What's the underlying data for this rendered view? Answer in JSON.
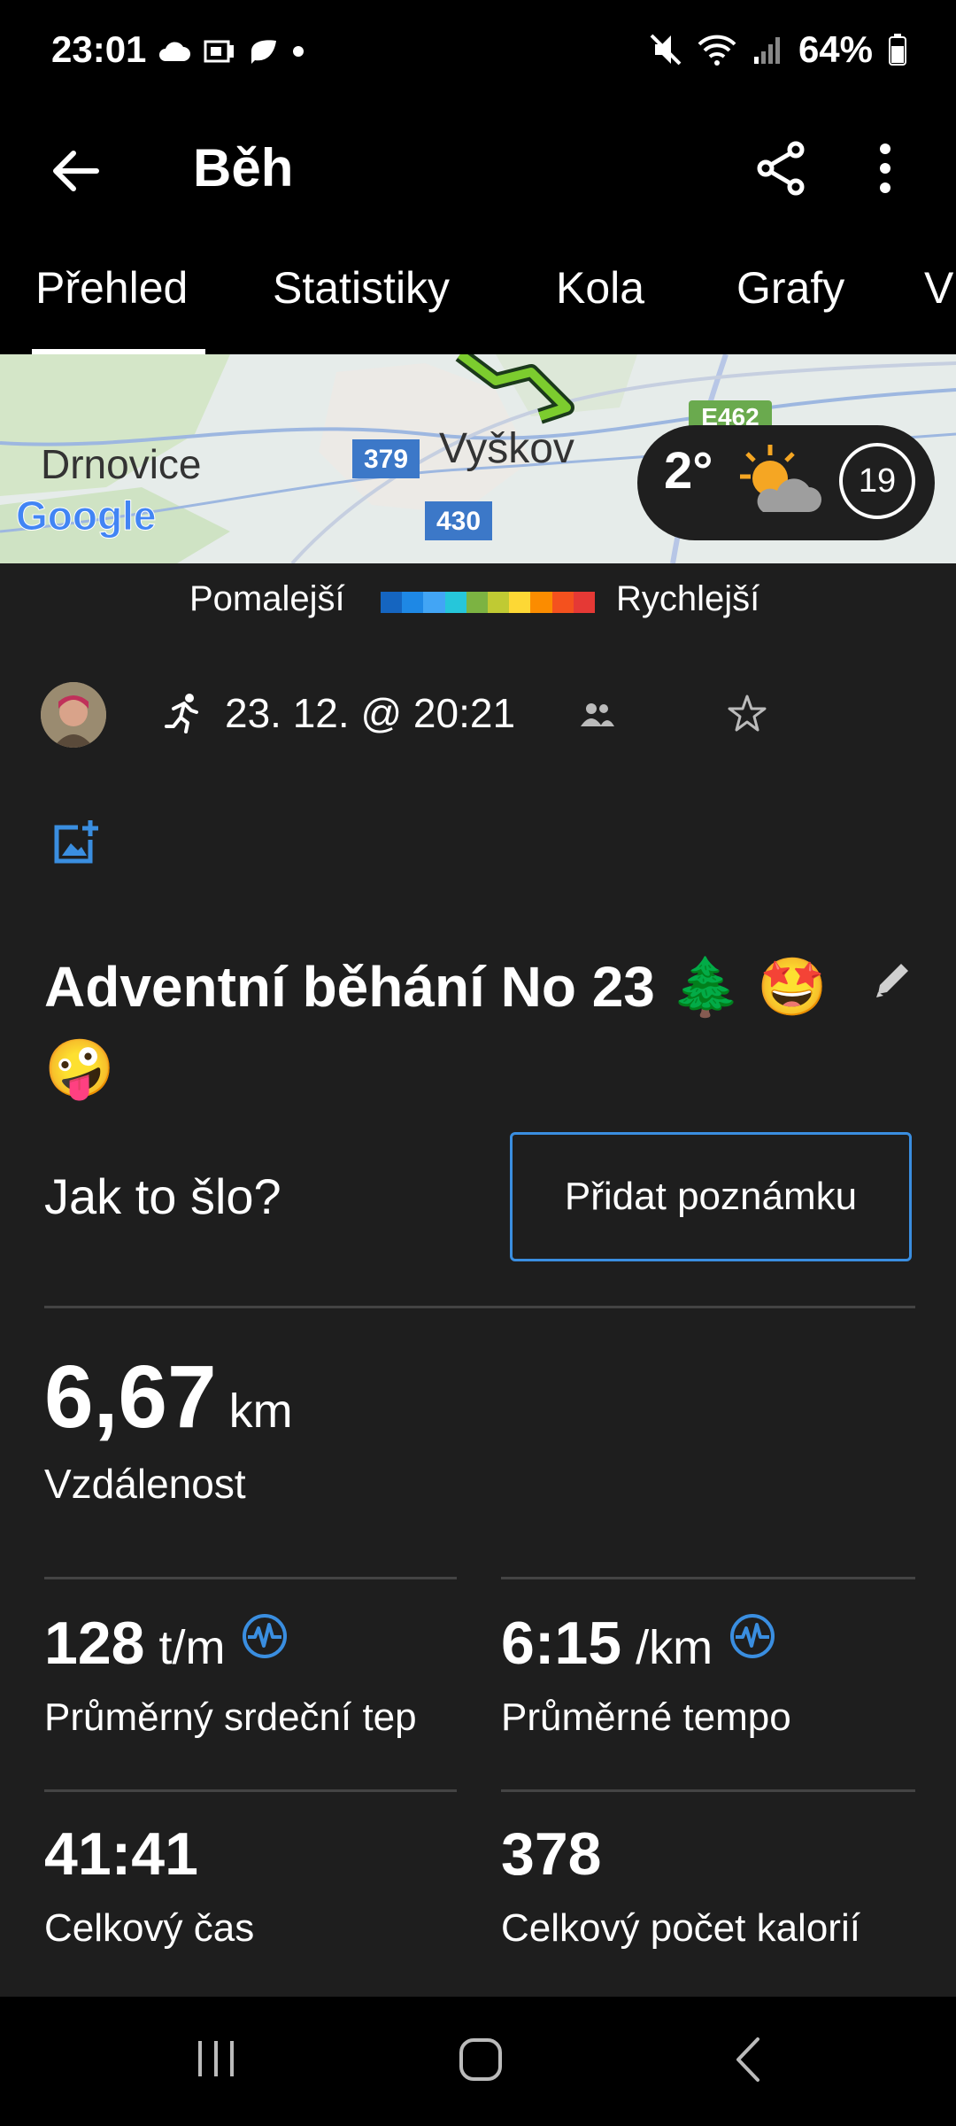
{
  "status_bar": {
    "time": "23:01",
    "battery": "64%",
    "left_icons": [
      "cloud-icon",
      "screen-icon",
      "leaf-icon",
      "dot-icon"
    ],
    "right_icons": [
      "mute-icon",
      "wifi-icon",
      "signal-icon",
      "battery-icon"
    ]
  },
  "app_bar": {
    "title": "Běh"
  },
  "tabs": [
    {
      "label": "Přehled",
      "active": true
    },
    {
      "label": "Statistiky",
      "active": false
    },
    {
      "label": "Kola",
      "active": false
    },
    {
      "label": "Grafy",
      "active": false
    },
    {
      "label": "V",
      "active": false
    }
  ],
  "map": {
    "labels": {
      "town1": "Drnovice",
      "town2": "Vyškov",
      "road1": "379",
      "road2": "430",
      "road3": "E462",
      "google": "Google"
    },
    "weather": {
      "temp": "2°",
      "laps": "19"
    }
  },
  "legend": {
    "slow": "Pomalejší",
    "fast": "Rychlejší",
    "colors": [
      "#1565c0",
      "#1e88e5",
      "#42a5f5",
      "#26c6da",
      "#7cb342",
      "#c0ca33",
      "#fdd835",
      "#fb8c00",
      "#f4511e",
      "#e53935"
    ]
  },
  "activity": {
    "date": "23. 12. @ 20:21",
    "name": "Adventní běhání No 23 🌲 🤩🤪"
  },
  "feedback": {
    "question": "Jak to šlo?",
    "add_note": "Přidat poznámku"
  },
  "stats": {
    "distance": {
      "value": "6,67",
      "unit": "km",
      "label": "Vzdálenost"
    },
    "heart_rate": {
      "value": "128",
      "unit": "t/m",
      "label": "Průměrný srdeční tep"
    },
    "pace": {
      "value": "6:15",
      "unit": "/km",
      "label": "Průměrné tempo"
    },
    "time": {
      "value": "41:41",
      "label": "Celkový čas"
    },
    "calories": {
      "value": "378",
      "label": "Celkový počet kalorií"
    }
  },
  "colors": {
    "accent": "#3a8ee0",
    "background": "#1e1e1e"
  }
}
